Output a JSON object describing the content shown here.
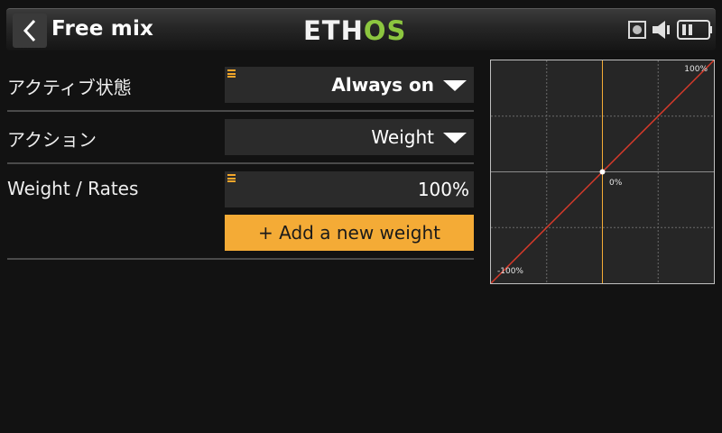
{
  "header": {
    "title": "Free mix",
    "logo_main": "ETH",
    "logo_accent": "OS",
    "icons": [
      "back-chevron-icon",
      "sd-card-icon",
      "speaker-icon",
      "battery-icon"
    ]
  },
  "rows": [
    {
      "label": "アクティブ状態",
      "value": "Always on",
      "has_menu": true,
      "has_dropdown": true
    },
    {
      "label": "アクション",
      "value": "Weight",
      "has_menu": false,
      "has_dropdown": true
    },
    {
      "label": "Weight / Rates",
      "value": "100%",
      "has_menu": true,
      "has_dropdown": false
    }
  ],
  "add_weight_button": "+ Add a new weight",
  "graph": {
    "label_top_right": "100%",
    "label_center": "0%",
    "label_bottom_left": "-100%",
    "curve": [
      [
        -100,
        -100
      ],
      [
        100,
        100
      ]
    ],
    "center_point": [
      0,
      0
    ],
    "curve_color": "#d83a2a",
    "cursor_color": "#f4ab36"
  },
  "colors": {
    "accent": "#f4ab36",
    "logo_green": "#8cc63f",
    "background": "#121212",
    "field_bg": "#2b2b2b"
  }
}
